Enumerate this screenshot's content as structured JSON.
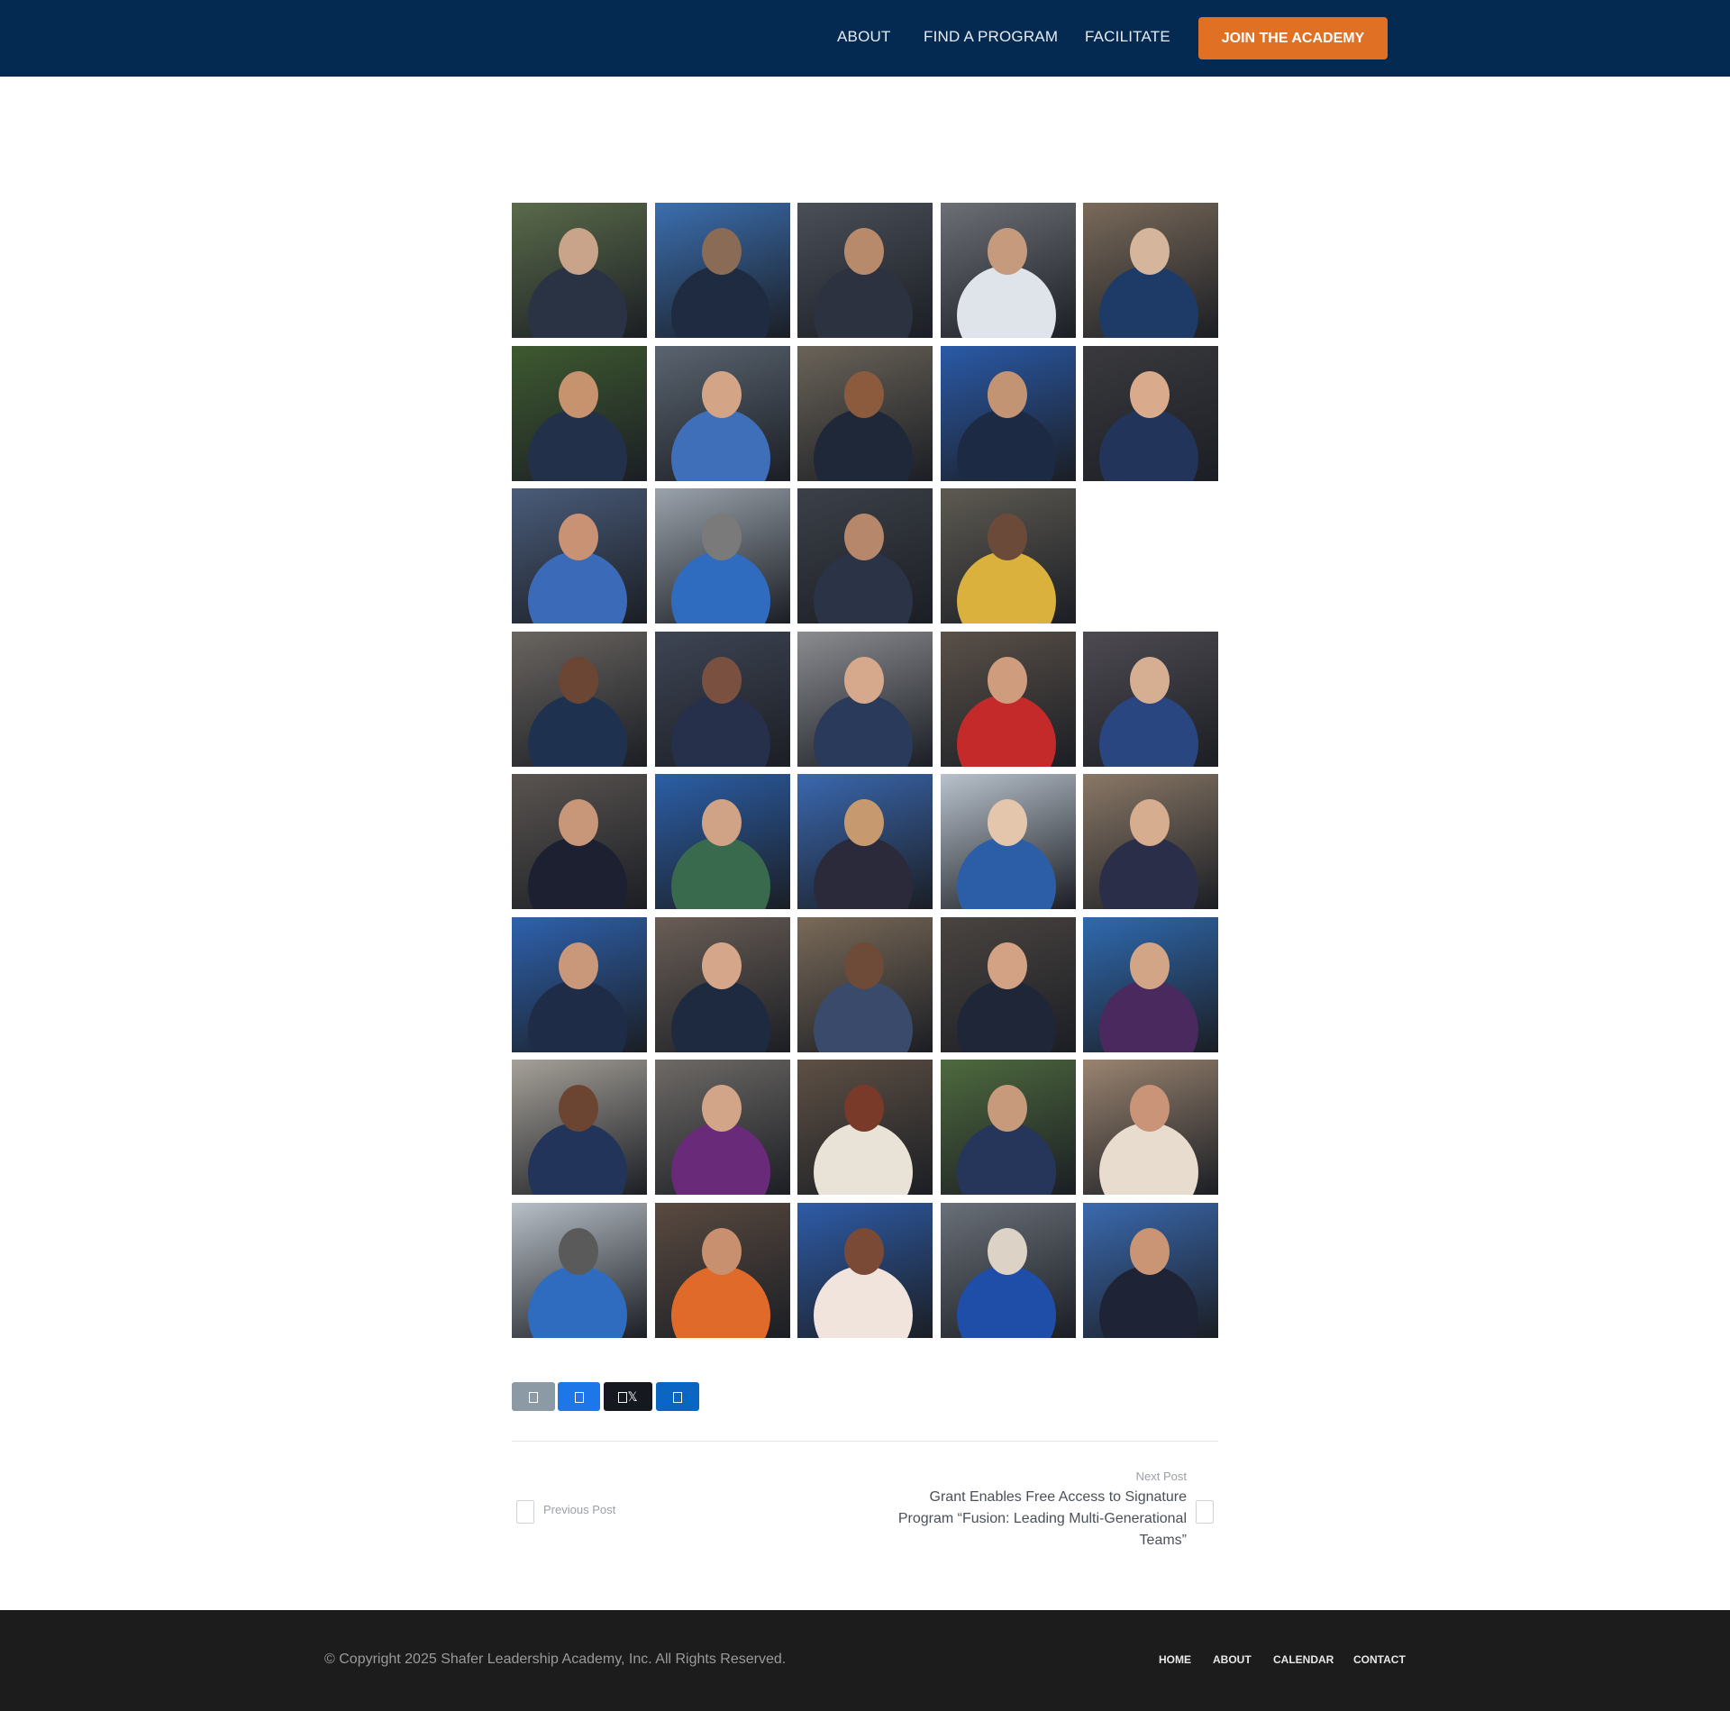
{
  "header": {
    "nav": [
      {
        "label": "ABOUT"
      },
      {
        "label": "FIND A PROGRAM"
      },
      {
        "label": "FACILITATE"
      }
    ],
    "cta_label": "JOIN THE ACADEMY"
  },
  "gallery": {
    "photos": [
      {
        "bg": "#5a6b4a",
        "a": "#2a3344",
        "b": "#c9a48a"
      },
      {
        "bg": "#3b6fb0",
        "a": "#1f2b40",
        "b": "#8a6b55"
      },
      {
        "bg": "#4a4f58",
        "a": "#2c3240",
        "b": "#b88a6c"
      },
      {
        "bg": "#6c6f75",
        "a": "#dfe3ea",
        "b": "#c69a7d"
      },
      {
        "bg": "#7a6a5a",
        "a": "#1e3a66",
        "b": "#d5b59c"
      },
      {
        "bg": "#3e5a30",
        "a": "#22304a",
        "b": "#c7936f"
      },
      {
        "bg": "#5a6470",
        "a": "#3f6fb8",
        "b": "#d3a486"
      },
      {
        "bg": "#6a6358",
        "a": "#1f2838",
        "b": "#8c5b3e"
      },
      {
        "bg": "#2a5aa8",
        "a": "#1d2a44",
        "b": "#c39474"
      },
      {
        "bg": "#3a3a3e",
        "a": "#22345a",
        "b": "#d9ab8c"
      },
      {
        "bg": "#4a5c7a",
        "a": "#3b6bb8",
        "b": "#c99274"
      },
      {
        "bg": "#9aa2ab",
        "a": "#2f6cc0",
        "b": "#7a7a7a"
      },
      {
        "bg": "#3c4048",
        "a": "#2a3446",
        "b": "#b6876a"
      },
      {
        "bg": "#5e5a52",
        "a": "#d9b13c",
        "b": "#6b4a3a"
      },
      {
        "bg": "#6a6560",
        "a": "#1e3250",
        "b": "#6b4634"
      },
      {
        "bg": "#3e4554",
        "a": "#26304a",
        "b": "#7a5140"
      },
      {
        "bg": "#8a8c90",
        "a": "#2a3a5a",
        "b": "#d7a98c"
      },
      {
        "bg": "#5a5048",
        "a": "#c42a2a",
        "b": "#cf9c7e"
      },
      {
        "bg": "#4e4a52",
        "a": "#2a4680",
        "b": "#d6ae92"
      },
      {
        "bg": "#5a5450",
        "a": "#1c2030",
        "b": "#c89679"
      },
      {
        "bg": "#2b5fa8",
        "a": "#3a6a4e",
        "b": "#d0a286"
      },
      {
        "bg": "#3a68b0",
        "a": "#2a2a3a",
        "b": "#c7996f"
      },
      {
        "bg": "#b9c2cc",
        "a": "#2c5ea8",
        "b": "#e4c6ad"
      },
      {
        "bg": "#8a7866",
        "a": "#2a2e48",
        "b": "#d7ad8f"
      },
      {
        "bg": "#2e62ae",
        "a": "#1f2c48",
        "b": "#c9977a"
      },
      {
        "bg": "#6a5e56",
        "a": "#1e2a40",
        "b": "#d6a68a"
      },
      {
        "bg": "#7a6a58",
        "a": "#3a4a6a",
        "b": "#6e4a38"
      },
      {
        "bg": "#4a4440",
        "a": "#1e2638",
        "b": "#d3a285"
      },
      {
        "bg": "#2f6ab0",
        "a": "#4a2a5e",
        "b": "#d2a587"
      },
      {
        "bg": "#a6a199",
        "a": "#22345a",
        "b": "#6b4532"
      },
      {
        "bg": "#6e6a66",
        "a": "#6a2a7a",
        "b": "#d2a588"
      },
      {
        "bg": "#5e5044",
        "a": "#e9e2d6",
        "b": "#7a3a2a"
      },
      {
        "bg": "#4e6a3e",
        "a": "#26365a",
        "b": "#c79a7c"
      },
      {
        "bg": "#9a8470",
        "a": "#e7dccd",
        "b": "#c99478"
      },
      {
        "bg": "#b8bfc6",
        "a": "#2f6cc0",
        "b": "#5a5a5a"
      },
      {
        "bg": "#5a4a40",
        "a": "#e06a2a",
        "b": "#c99070"
      },
      {
        "bg": "#2e5ca8",
        "a": "#f1e4dc",
        "b": "#7a4a36"
      },
      {
        "bg": "#6a7078",
        "a": "#1f4ea8",
        "b": "#dcd2c6"
      },
      {
        "bg": "#3a6ab0",
        "a": "#1e2436",
        "b": "#c99574"
      }
    ]
  },
  "share": {
    "x_label": "𝕏"
  },
  "post_nav": {
    "prev_label": "Previous Post",
    "next_label": "Next Post",
    "next_title": "Grant Enables Free Access to Signature Program “Fusion: Leading Multi-Generational Teams”"
  },
  "footer": {
    "copyright": "© Copyright 2025 Shafer Leadership Academy, Inc. All Rights Reserved.",
    "links": [
      {
        "label": "HOME"
      },
      {
        "label": "ABOUT"
      },
      {
        "label": "CALENDAR"
      },
      {
        "label": "CONTACT"
      }
    ]
  }
}
